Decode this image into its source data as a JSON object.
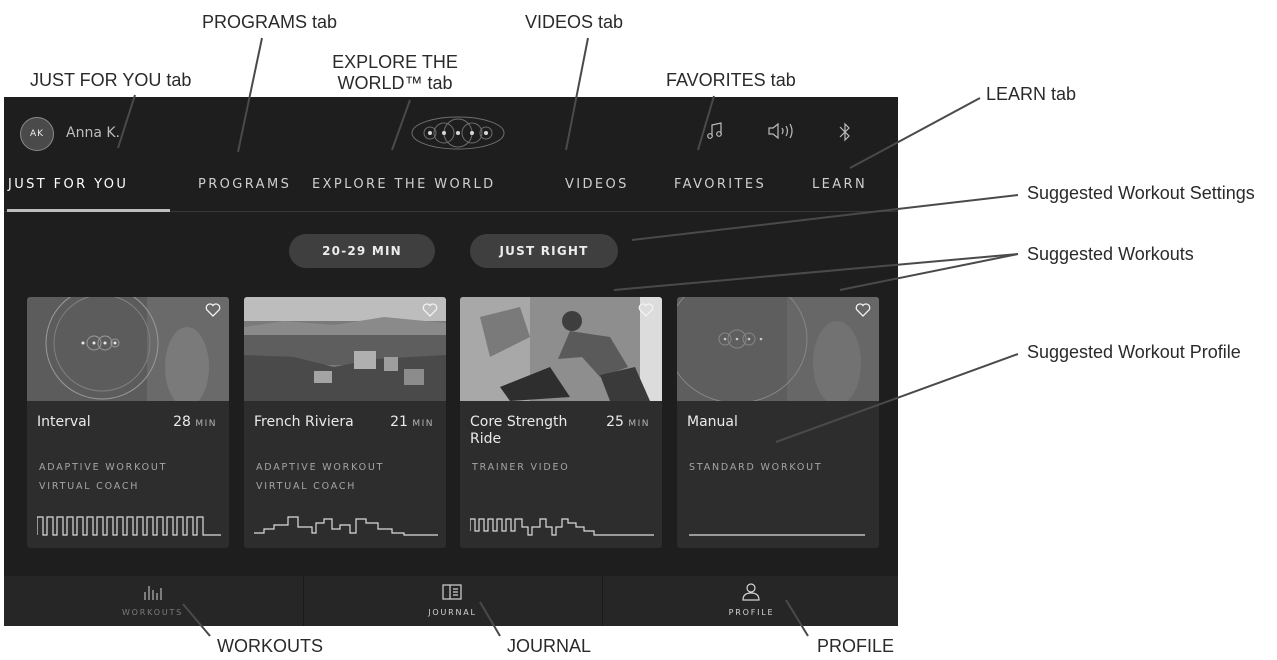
{
  "callouts": {
    "just_for_you_tab": "JUST FOR YOU tab",
    "programs_tab": "PROGRAMS tab",
    "explore_tab_line1": "EXPLORE THE",
    "explore_tab_line2": "WORLD™ tab",
    "videos_tab": "VIDEOS tab",
    "favorites_tab": "FAVORITES tab",
    "learn_tab": "LEARN tab",
    "suggested_workout_settings": "Suggested Workout Settings",
    "suggested_workouts": "Suggested Workouts",
    "suggested_workout_profile": "Suggested Workout Profile",
    "workouts": "WORKOUTS",
    "journal": "JOURNAL",
    "profile": "PROFILE"
  },
  "header": {
    "avatar_initials": "AK",
    "user_name": "Anna K.",
    "icons": [
      "music-icon",
      "volume-icon",
      "bluetooth-icon"
    ]
  },
  "tabs": [
    {
      "label": "JUST FOR YOU",
      "active": true
    },
    {
      "label": "PROGRAMS"
    },
    {
      "label": "EXPLORE THE WORLD"
    },
    {
      "label": "VIDEOS"
    },
    {
      "label": "FAVORITES"
    },
    {
      "label": "LEARN"
    }
  ],
  "settings": {
    "duration": "20-29 MIN",
    "intensity": "JUST RIGHT"
  },
  "workouts": [
    {
      "title": "Interval",
      "minutes": "28",
      "unit": "MIN",
      "line1": "ADAPTIVE WORKOUT",
      "line2": "VIRTUAL COACH"
    },
    {
      "title": "French Riviera",
      "minutes": "21",
      "unit": "MIN",
      "line1": "ADAPTIVE WORKOUT",
      "line2": "VIRTUAL COACH"
    },
    {
      "title": "Core Strength Ride",
      "minutes": "25",
      "unit": "MIN",
      "line1": "TRAINER VIDEO",
      "line2": ""
    },
    {
      "title": "Manual",
      "minutes": "",
      "unit": "",
      "line1": "STANDARD WORKOUT",
      "line2": ""
    }
  ],
  "bottom_nav": [
    {
      "label": "WORKOUTS",
      "icon": "bar-chart-icon"
    },
    {
      "label": "JOURNAL",
      "icon": "journal-icon"
    },
    {
      "label": "PROFILE",
      "icon": "person-icon"
    }
  ],
  "colors": {
    "screen_bg": "#1e1e1e",
    "card_bg": "#2d2d2d",
    "pill_bg": "#3f3f3f",
    "nav_bg": "#262626"
  }
}
